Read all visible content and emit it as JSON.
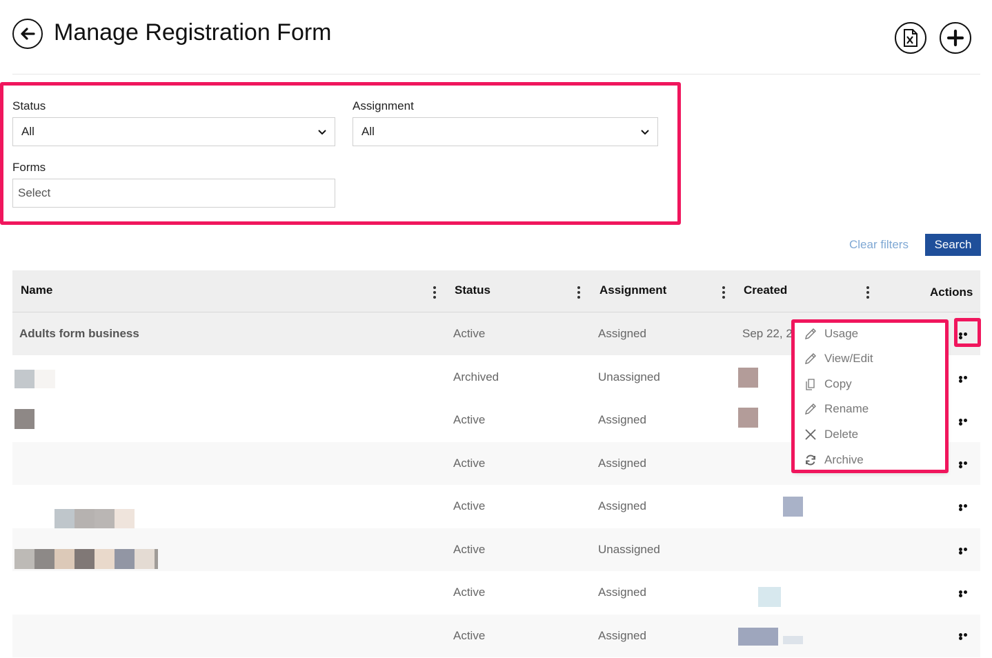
{
  "header": {
    "title": "Manage Registration Form",
    "back_icon": "arrow-left-circle-icon",
    "export_icon": "excel-file-icon",
    "add_icon": "plus-circle-icon"
  },
  "filters": {
    "status": {
      "label": "Status",
      "value": "All"
    },
    "assignment": {
      "label": "Assignment",
      "value": "All"
    },
    "forms": {
      "label": "Forms",
      "placeholder": "Select"
    },
    "clear_label": "Clear filters",
    "search_label": "Search"
  },
  "table": {
    "columns": [
      "Name",
      "Status",
      "Assignment",
      "Created",
      "Actions"
    ],
    "rows": [
      {
        "name": "Adults form business",
        "status": "Active",
        "assignment": "Assigned",
        "created": "Sep 22, 2"
      },
      {
        "name": "",
        "status": "Archived",
        "assignment": "Unassigned",
        "created": ""
      },
      {
        "name": "",
        "status": "Active",
        "assignment": "Assigned",
        "created": ""
      },
      {
        "name": "",
        "status": "Active",
        "assignment": "Assigned",
        "created": ""
      },
      {
        "name": "",
        "status": "Active",
        "assignment": "Assigned",
        "created": ""
      },
      {
        "name": "",
        "status": "Active",
        "assignment": "Unassigned",
        "created": ""
      },
      {
        "name": "",
        "status": "Active",
        "assignment": "Assigned",
        "created": ""
      },
      {
        "name": "",
        "status": "Active",
        "assignment": "Assigned",
        "created": ""
      }
    ]
  },
  "actions_menu": {
    "items": [
      {
        "label": "Usage",
        "icon": "pencil-icon"
      },
      {
        "label": "View/Edit",
        "icon": "pencil-icon"
      },
      {
        "label": "Copy",
        "icon": "copy-icon"
      },
      {
        "label": "Rename",
        "icon": "pencil-icon"
      },
      {
        "label": "Delete",
        "icon": "close-icon"
      },
      {
        "label": "Archive",
        "icon": "refresh-icon"
      }
    ]
  },
  "colors": {
    "highlight": "#f0165d",
    "primary_button": "#1f4f9a",
    "link": "#7fa8d4"
  }
}
